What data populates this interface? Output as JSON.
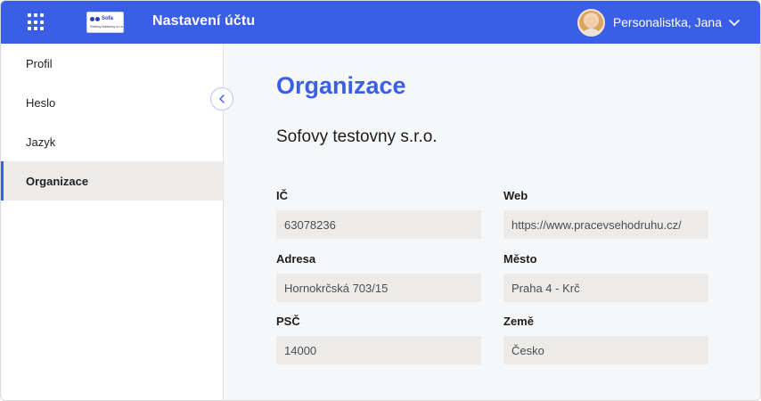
{
  "header": {
    "title": "Nastavení účtu",
    "logo": {
      "name": "Sofa",
      "subtitle": "Sofovy testovny s.r.o."
    },
    "user_name": "Personalistka, Jana",
    "accent_color": "#3b5ee6"
  },
  "sidebar": {
    "items": [
      {
        "label": "Profil",
        "active": false
      },
      {
        "label": "Heslo",
        "active": false
      },
      {
        "label": "Jazyk",
        "active": false
      },
      {
        "label": "Organizace",
        "active": true
      }
    ]
  },
  "main": {
    "title": "Organizace",
    "org_name": "Sofovy testovny s.r.o.",
    "fields": {
      "ic": {
        "label": "IČ",
        "value": "63078236"
      },
      "web": {
        "label": "Web",
        "value": "https://www.pracevsehodruhu.cz/"
      },
      "address": {
        "label": "Adresa",
        "value": "Hornokrčská 703/15"
      },
      "city": {
        "label": "Město",
        "value": "Praha 4 - Krč"
      },
      "zip": {
        "label": "PSČ",
        "value": "14000"
      },
      "country": {
        "label": "Země",
        "value": "Česko"
      }
    }
  },
  "icons": {
    "apps": "apps-grid-icon",
    "collapse": "chevron-left-icon",
    "user_menu": "chevron-down-icon"
  }
}
